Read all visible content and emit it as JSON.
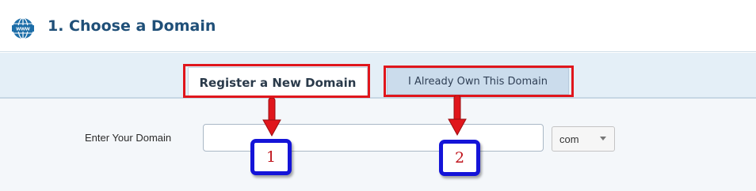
{
  "header": {
    "icon_text": "www",
    "icon": "globe-www-icon",
    "title": "1. Choose a Domain"
  },
  "tabs": [
    {
      "label": "Register a New Domain",
      "active": true
    },
    {
      "label": "I Already Own This Domain",
      "active": false
    }
  ],
  "form": {
    "domain_label": "Enter Your Domain",
    "domain_value": "",
    "domain_placeholder": "",
    "tld_selected": "com"
  },
  "annotations": {
    "badge_1": "1",
    "badge_2": "2",
    "highlight_color": "#e0161c",
    "badge_border_color": "#1414d8"
  },
  "colors": {
    "title": "#1f4f78",
    "tab_band": "#e4eff7",
    "inactive_tab": "#cbdcec",
    "content_bg": "#f4f7fa"
  }
}
